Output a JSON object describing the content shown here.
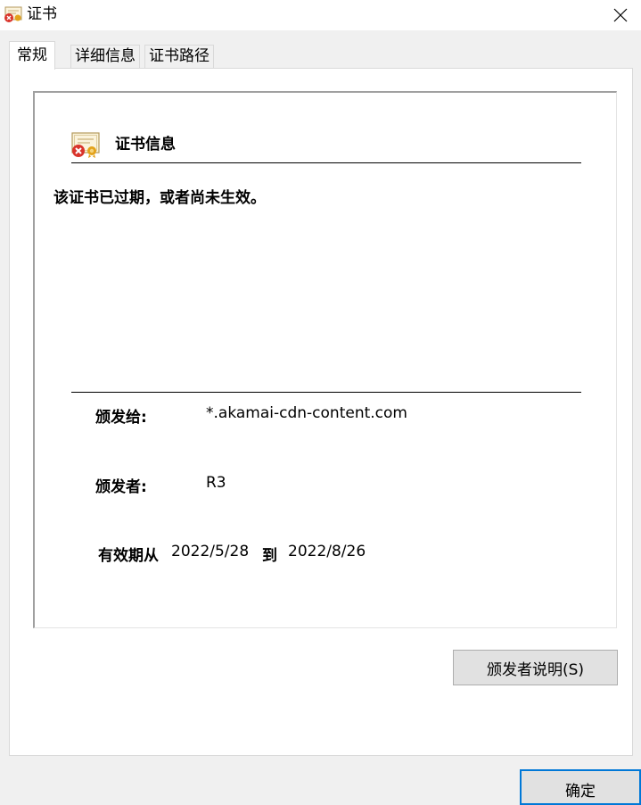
{
  "window": {
    "title": "证书",
    "close_glyph": "✕"
  },
  "tabs": [
    {
      "label": "常规",
      "active": true
    },
    {
      "label": "详细信息",
      "active": false
    },
    {
      "label": "证书路径",
      "active": false
    }
  ],
  "general": {
    "section_heading": "证书信息",
    "status_message": "该证书已过期，或者尚未生效。",
    "issued_to_label": "颁发给:",
    "issued_to_value": "*.akamai-cdn-content.com",
    "issued_by_label": "颁发者:",
    "issued_by_value": "R3",
    "valid_from_label": "有效期从",
    "valid_from_value": "2022/5/28",
    "valid_to_label": "到",
    "valid_to_value": "2022/8/26"
  },
  "buttons": {
    "issuer_statement": "颁发者说明(S)",
    "ok": "确定"
  },
  "icons": {
    "title_icon": "certificate-error-icon",
    "info_icon": "certificate-error-icon",
    "close": "close-icon"
  },
  "colors": {
    "error_red": "#d9342b",
    "seal_gold": "#e3a21a",
    "focus_blue": "#0078d7"
  }
}
